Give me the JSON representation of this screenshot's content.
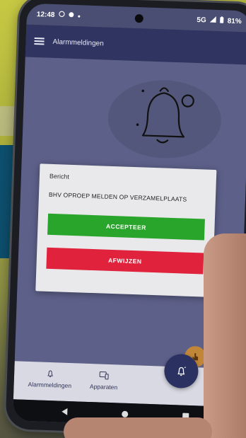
{
  "status_bar": {
    "time": "12:48",
    "network": "5G",
    "battery": "81%"
  },
  "app_bar": {
    "title": "Alarmmeldingen"
  },
  "dialog": {
    "title": "Bericht",
    "message": "BHV OPROEP MELDEN OP VERZAMELPLAATS",
    "accept_label": "ACCEPTEER",
    "reject_label": "AFWIJZEN"
  },
  "bottom_nav": {
    "items": [
      {
        "label": "Alarmmeldingen",
        "icon": "bell-icon"
      },
      {
        "label": "Apparaten",
        "icon": "devices-icon"
      }
    ]
  },
  "colors": {
    "app_bar": "#2f3460",
    "accept": "#2aa52c",
    "reject": "#e0223c",
    "fab": "#2b3160",
    "fab_small": "#c18638"
  }
}
